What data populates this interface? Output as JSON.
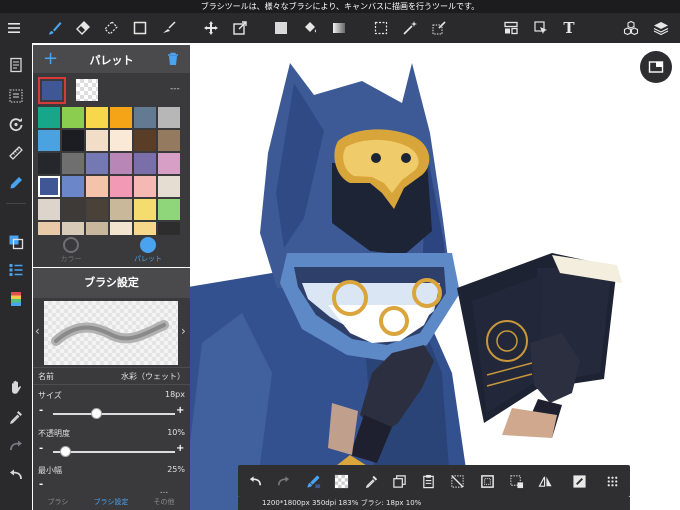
{
  "status_bar": {
    "text": "ブラシツールは、様々なブラシにより、キャンバスに描画を行うツールです。"
  },
  "top_toolbar": {
    "icons": [
      "menu-icon",
      "brush-icon",
      "eraser-icon",
      "blur-eraser-icon",
      "rect-shape-icon",
      "select-pen-icon",
      "move-icon",
      "transform-icon",
      "color-fill-icon",
      "bucket-icon",
      "gradient-icon",
      "selection-rect-icon",
      "magic-wand-icon",
      "selection-pen-icon",
      "layout-icon",
      "select-arrow-icon",
      "text-icon",
      "materials-icon",
      "layers-icon"
    ],
    "text_tool_label": "T"
  },
  "left_sidebar": {
    "icons": [
      "document-icon",
      "hide-panels-icon",
      "rotate-icon",
      "ruler-icon",
      "fill-icon",
      "color-panel-icon",
      "brush-list-icon",
      "palette-panel-icon",
      "hand-icon",
      "eyedropper-icon",
      "redo-icon",
      "undo-icon"
    ]
  },
  "palette_panel": {
    "title": "パレット",
    "add_label": "+",
    "current_color": "#3f5794",
    "color_name": "---",
    "swatches": [
      "#17a689",
      "#8bcd4f",
      "#f7d84a",
      "#f5a418",
      "#627b92",
      "#b7b7b7",
      "#4aa3e0",
      "#1b1d22",
      "#f2ddc8",
      "#fbe9d7",
      "#5a3d26",
      "#947a5e",
      "#25272c",
      "#6f6f6f",
      "#7479b4",
      "#b887b8",
      "#7a6fa8",
      "#d79fc6",
      "#3f5794",
      "#6b87c9",
      "#f5c3aa",
      "#f29ab5",
      "#f5b8b2",
      "#e6ddd2",
      "#ddd5cc",
      "#3d3a37",
      "#4a4238",
      "#c9b99a",
      "#f5dc6e",
      "#8fd67a",
      "#e8c9a8",
      "#d8cbb8",
      "#c8b79c",
      "#f2e4ce",
      "#f6d88a",
      "#2d2d2d"
    ],
    "selected_index": 18,
    "tabs": [
      {
        "label": "カラー"
      },
      {
        "label": "パレット"
      }
    ]
  },
  "brush_panel": {
    "title": "ブラシ設定",
    "name_label": "名前",
    "name_value": "水彩（ウェット）",
    "size_label": "サイズ",
    "size_value": "18px",
    "size_fraction": 0.36,
    "opacity_label": "不透明度",
    "opacity_value": "10%",
    "opacity_fraction": 0.1,
    "min_width_label": "最小幅",
    "min_width_value": "25%",
    "minus": "-",
    "plus": "+",
    "tabs": [
      {
        "label": "ブラシ"
      },
      {
        "label": "ブラシ設定"
      },
      {
        "label": "その他"
      }
    ],
    "more_label": "..."
  },
  "bottom_toolbar": {
    "icons": [
      "undo-icon",
      "redo-icon",
      "brush-color-icon",
      "transparent-color-icon",
      "eyedropper-icon",
      "copy-layer-icon",
      "paste-icon",
      "clear-selection-icon",
      "select-all-icon",
      "transform-selection-icon",
      "flip-horizontal-icon",
      "edit-icon",
      "grid-menu-icon"
    ],
    "info": "1200*1800px 350dpi 183% ブラシ: 18px 10%"
  }
}
